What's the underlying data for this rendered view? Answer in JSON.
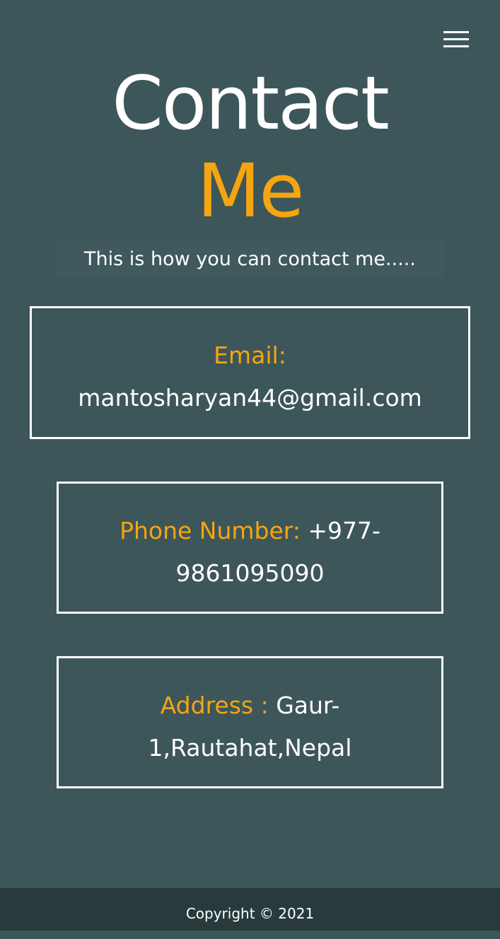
{
  "header": {
    "menu_icon": "hamburger-menu-icon"
  },
  "title": {
    "line1": "Contact",
    "line2": "Me"
  },
  "subtitle": "This is how you can contact me.....",
  "contacts": {
    "email": {
      "label": "Email:",
      "value": "mantosharyan44@gmail.com"
    },
    "phone": {
      "label": "Phone Number:",
      "value_part1": "+977-",
      "value_part2": "9861095090"
    },
    "address": {
      "label": "Address :",
      "value_part1": "Gaur-",
      "value_part2": "1,Rautahat,Nepal"
    }
  },
  "footer": {
    "copyright": "Copyright © 2021"
  },
  "colors": {
    "background": "#3d5659",
    "accent": "#f5a511",
    "footer_background": "#283a3c",
    "text": "#ffffff"
  }
}
